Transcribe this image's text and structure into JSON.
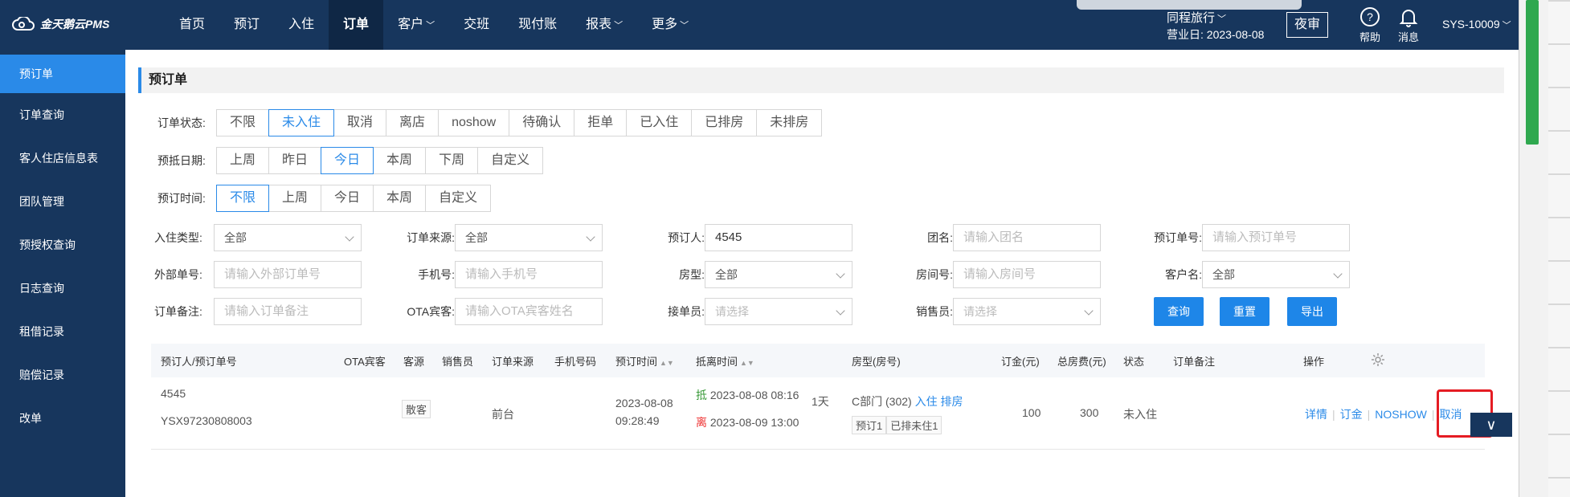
{
  "app": {
    "logo_text": "金天鹅云PMS"
  },
  "nav": [
    {
      "label": "首页"
    },
    {
      "label": "预订"
    },
    {
      "label": "入住"
    },
    {
      "label": "订单"
    },
    {
      "label": "客户",
      "dropdown": true
    },
    {
      "label": "交班"
    },
    {
      "label": "现付账"
    },
    {
      "label": "报表",
      "dropdown": true
    },
    {
      "label": "更多",
      "dropdown": true
    }
  ],
  "header": {
    "hotel": "同程旅行",
    "business_date": "营业日: 2023-08-08",
    "night_audit": "夜审",
    "help": "帮助",
    "messages": "消息",
    "user": "SYS-10009"
  },
  "sidebar": {
    "items": [
      {
        "label": "预订单"
      },
      {
        "label": "订单查询"
      },
      {
        "label": "客人住店信息表"
      },
      {
        "label": "团队管理"
      },
      {
        "label": "预授权查询"
      },
      {
        "label": "日志查询"
      },
      {
        "label": "租借记录"
      },
      {
        "label": "赔偿记录"
      },
      {
        "label": "改单"
      }
    ]
  },
  "page": {
    "title": "预订单"
  },
  "filters": {
    "status": {
      "label": "订单状态:",
      "options": [
        "不限",
        "未入住",
        "取消",
        "离店",
        "noshow",
        "待确认",
        "拒单",
        "已入住",
        "已排房",
        "未排房"
      ],
      "selected": "未入住"
    },
    "arrival_date": {
      "label": "预抵日期:",
      "options": [
        "上周",
        "昨日",
        "今日",
        "本周",
        "下周",
        "自定义"
      ],
      "selected": "今日"
    },
    "booking_time": {
      "label": "预订时间:",
      "options": [
        "不限",
        "上周",
        "今日",
        "本周",
        "自定义"
      ],
      "selected": "不限"
    }
  },
  "fields": {
    "checkin_type": {
      "label": "入住类型:",
      "value": "全部"
    },
    "order_source": {
      "label": "订单来源:",
      "value": "全部"
    },
    "booker": {
      "label": "预订人:",
      "value": "4545"
    },
    "group_name": {
      "label": "团名:",
      "placeholder": "请输入团名"
    },
    "booking_no": {
      "label": "预订单号:",
      "placeholder": "请输入预订单号"
    },
    "external_no": {
      "label": "外部单号:",
      "placeholder": "请输入外部订单号"
    },
    "phone": {
      "label": "手机号:",
      "placeholder": "请输入手机号"
    },
    "room_type": {
      "label": "房型:",
      "value": "全部"
    },
    "room_no": {
      "label": "房间号:",
      "placeholder": "请输入房间号"
    },
    "customer_name": {
      "label": "客户名:",
      "value": "全部"
    },
    "order_note": {
      "label": "订单备注:",
      "placeholder": "请输入订单备注"
    },
    "ota_guest": {
      "label": "OTA宾客:",
      "placeholder": "请输入OTA宾客姓名"
    },
    "receiver": {
      "label": "接单员:",
      "placeholder": "请选择"
    },
    "salesperson": {
      "label": "销售员:",
      "placeholder": "请选择"
    }
  },
  "buttons": {
    "query": "查询",
    "reset": "重置",
    "export": "导出"
  },
  "table": {
    "headers": {
      "booker": "预订人/预订单号",
      "ota": "OTA宾客",
      "source_type": "客源",
      "sales": "销售员",
      "order_source": "订单来源",
      "phone": "手机号码",
      "booking_time": "预订时间",
      "stay_time": "抵离时间",
      "room": "房型(房号)",
      "deposit": "订金(元)",
      "total": "总房费(元)",
      "status": "状态",
      "note": "订单备注",
      "ops": "操作"
    },
    "rows": [
      {
        "booker": "4545",
        "booking_no": "YSX97230808003",
        "source_type": "散客",
        "order_source": "前台",
        "booking_date": "2023-08-08",
        "booking_clock": "09:28:49",
        "arrive_mark": "抵",
        "arrive": "2023-08-08 08:16",
        "nights": "1天",
        "leave_mark": "离",
        "leave": "2023-08-09 13:00",
        "room": "C部门 (302)",
        "room_checkin": "入住",
        "room_assign": "排房",
        "tag1": "预订1",
        "tag2": "已排未住1",
        "deposit": "100",
        "total": "300",
        "status": "未入住",
        "op_detail": "详情",
        "op_deposit": "订金",
        "op_noshow": "NOSHOW",
        "op_cancel": "取消"
      }
    ]
  },
  "colors": {
    "nav_bg": "#17365d",
    "accent": "#2a8ae8",
    "highlight": "#e51c23"
  }
}
